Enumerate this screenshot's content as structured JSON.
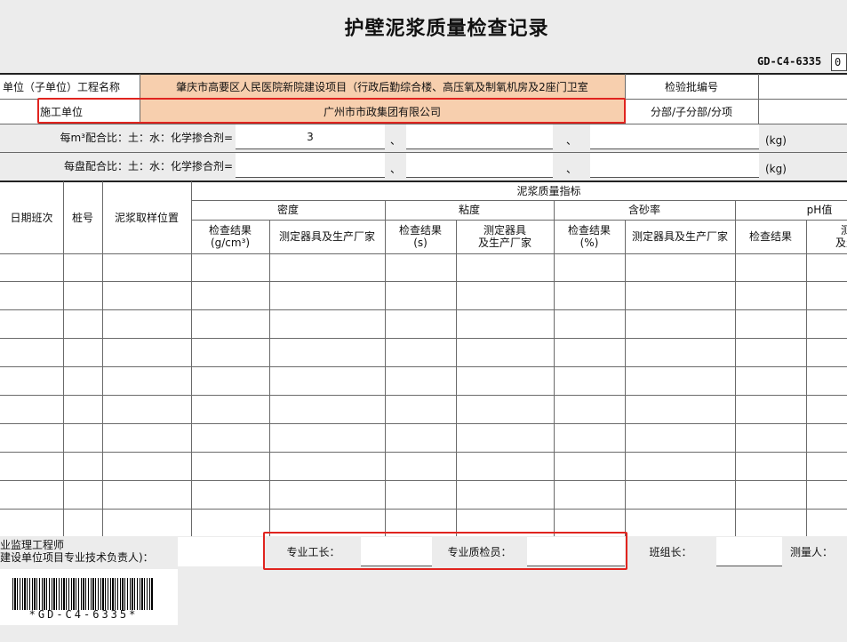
{
  "title": "护壁泥浆质量检查记录",
  "form_code": "GD-C4-6335",
  "form_code_suffix": "0",
  "row1": {
    "project_label": "单位（子单位）工程名称",
    "project_value": "肇庆市高要区人民医院新院建设项目（行政后勤综合楼、高压氧及制氧机房及2座门卫室",
    "batch_label": "检验批编号",
    "batch_value": ""
  },
  "row2": {
    "contractor_label": "施工单位",
    "contractor_value": "广州市市政集团有限公司",
    "division_label": "分部/子分部/分项",
    "division_value": ""
  },
  "row3": {
    "mix_label": "每m³配合比：土：水：化学掺合剂=",
    "value1": "3",
    "sep1": "、",
    "value2": "",
    "sep2": "、",
    "value3": "",
    "unit": "(kg)"
  },
  "row4": {
    "mix_label": "每盘配合比：土：水：化学掺合剂=",
    "value1": "",
    "sep1": "、",
    "value2": "",
    "sep2": "、",
    "value3": "",
    "unit": "(kg)"
  },
  "table": {
    "date_shift": "日期班次",
    "pile_no": "桩号",
    "sample_pos": "泥浆取样位置",
    "indicators": "泥浆质量指标",
    "density": "密度",
    "viscosity": "粘度",
    "sand": "含砂率",
    "ph": "pH值",
    "density_result": "检查结果",
    "density_unit": "(g/cm³)",
    "density_instrument": "测定器具及生产厂家",
    "viscosity_result": "检查结果",
    "viscosity_unit": "(s)",
    "viscosity_instrument_l1": "测定器具",
    "viscosity_instrument_l2": "及生产厂家",
    "sand_result": "检查结果",
    "sand_unit": "(%)",
    "sand_instrument": "测定器具及生产厂家",
    "ph_result": "检查结果",
    "ph_instrument_l1": "测",
    "ph_instrument_l2": "及生"
  },
  "footer": {
    "supervisor_l1": "业监理工程师",
    "supervisor_l2": "建设单位项目专业技术负责人)：",
    "foreman_label": "专业工长：",
    "foreman_value": "",
    "inspector_label": "专业质检员：",
    "inspector_value": "",
    "team_leader_label": "班组长：",
    "team_leader_value": "",
    "surveyor_label": "测量人："
  },
  "barcode_text": "*GD-C4-6335*",
  "colors": {
    "highlight": "#f7cfae",
    "red_box": "#e0241f"
  }
}
